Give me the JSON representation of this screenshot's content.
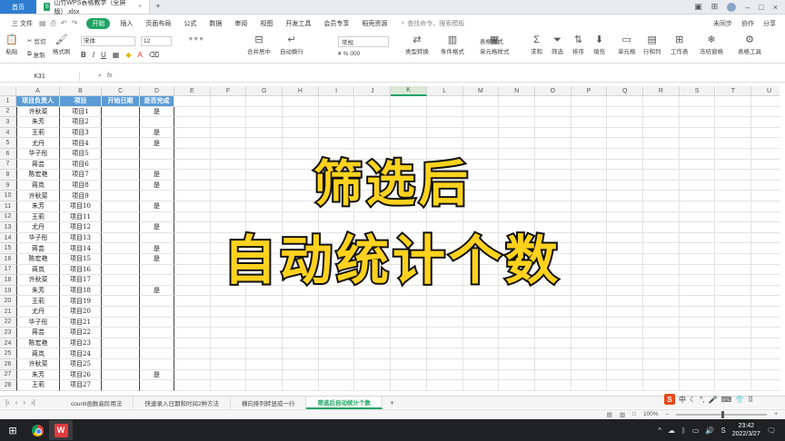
{
  "titlebar": {
    "home_tab": "首页",
    "doc_tab": "山竹WPS表格教学（全屏版）.xlsx",
    "doc_icon": "S",
    "plus": "+"
  },
  "menubar": {
    "file": "三 文件",
    "items": [
      "开始",
      "插入",
      "页面布局",
      "公式",
      "数据",
      "审阅",
      "视图",
      "开发工具",
      "会员专享",
      "稻壳资源"
    ],
    "search": "查找命令、搜索模板",
    "right": [
      "未同步",
      "协作",
      "分享"
    ]
  },
  "toolbar": {
    "paste": "粘贴",
    "cut": "剪切",
    "copy": "复制",
    "format_painter": "格式刷",
    "font": "宋体",
    "size": "12",
    "merge": "合并居中",
    "wrap": "自动换行",
    "number_format": "常规",
    "type_convert": "类型转换",
    "conditional": "条件格式",
    "cell_style": "单元格样式",
    "table_style": "表格样式",
    "sum": "求和",
    "filter": "筛选",
    "sort": "排序",
    "fill": "填充",
    "cell": "单元格",
    "row_col": "行和列",
    "worksheet": "工作表",
    "freeze": "冻结窗格",
    "table_tools": "表格工具"
  },
  "formula": {
    "namebox": "K31",
    "fx": "fx"
  },
  "grid": {
    "columns": [
      "A",
      "B",
      "C",
      "D",
      "E",
      "F",
      "G",
      "H",
      "I",
      "J",
      "K",
      "L",
      "M",
      "N",
      "O",
      "P",
      "Q",
      "R",
      "S",
      "T",
      "U"
    ],
    "active_column": "K",
    "headers": [
      "项目负责人",
      "项目",
      "开始日期",
      "是否完成"
    ],
    "rows": [
      {
        "n": "1",
        "a": "项目负责人",
        "b": "项目",
        "c": "开始日期",
        "d": "是否完成"
      },
      {
        "n": "2",
        "a": "许秋菜",
        "b": "项目1",
        "d": "是"
      },
      {
        "n": "3",
        "a": "朱芳",
        "b": "项目2",
        "d": ""
      },
      {
        "n": "4",
        "a": "王莉",
        "b": "项目3",
        "d": "是"
      },
      {
        "n": "5",
        "a": "尤丹",
        "b": "项目4",
        "d": "是"
      },
      {
        "n": "6",
        "a": "华子彤",
        "b": "项目5",
        "d": ""
      },
      {
        "n": "7",
        "a": "蒋芸",
        "b": "项目6",
        "d": ""
      },
      {
        "n": "8",
        "a": "陈宏艳",
        "b": "项目7",
        "d": "是"
      },
      {
        "n": "9",
        "a": "蒋岚",
        "b": "项目8",
        "d": "是"
      },
      {
        "n": "10",
        "a": "许秋菜",
        "b": "项目9",
        "d": ""
      },
      {
        "n": "11",
        "a": "朱芳",
        "b": "项目10",
        "d": "是"
      },
      {
        "n": "12",
        "a": "王莉",
        "b": "项目11",
        "d": ""
      },
      {
        "n": "13",
        "a": "尤丹",
        "b": "项目12",
        "d": "是"
      },
      {
        "n": "14",
        "a": "华子彤",
        "b": "项目13",
        "d": ""
      },
      {
        "n": "15",
        "a": "蒋芸",
        "b": "项目14",
        "d": "是"
      },
      {
        "n": "16",
        "a": "陈宏艳",
        "b": "项目15",
        "d": "是"
      },
      {
        "n": "17",
        "a": "蒋岚",
        "b": "项目16",
        "d": ""
      },
      {
        "n": "18",
        "a": "许秋菜",
        "b": "项目17",
        "d": ""
      },
      {
        "n": "19",
        "a": "朱芳",
        "b": "项目18",
        "d": "是"
      },
      {
        "n": "20",
        "a": "王莉",
        "b": "项目19",
        "d": ""
      },
      {
        "n": "21",
        "a": "尤丹",
        "b": "项目20",
        "d": ""
      },
      {
        "n": "22",
        "a": "华子彤",
        "b": "项目21",
        "d": ""
      },
      {
        "n": "23",
        "a": "蒋芸",
        "b": "项目22",
        "d": ""
      },
      {
        "n": "24",
        "a": "陈宏艳",
        "b": "项目23",
        "d": ""
      },
      {
        "n": "25",
        "a": "蒋岚",
        "b": "项目24",
        "d": ""
      },
      {
        "n": "26",
        "a": "许秋菜",
        "b": "项目25",
        "d": ""
      },
      {
        "n": "27",
        "a": "朱芳",
        "b": "项目26",
        "d": "是"
      },
      {
        "n": "28",
        "a": "王莉",
        "b": "项目27",
        "d": ""
      }
    ]
  },
  "overlay": {
    "line1": "筛选后",
    "line2": "自动统计个数"
  },
  "sheets": {
    "tabs": [
      "counti函数高阶用法",
      "快速录入日期和时间2种方法",
      "横向排列转竖成一行",
      "筛选后自动统计个数"
    ],
    "active": "筛选后自动统计个数",
    "add": "+"
  },
  "ime": {
    "logo": "S",
    "lang": "中"
  },
  "status": {
    "zoom": "100%"
  },
  "taskbar": {
    "wps_label": "W",
    "time": "23:42",
    "date": "2022/3/27"
  }
}
